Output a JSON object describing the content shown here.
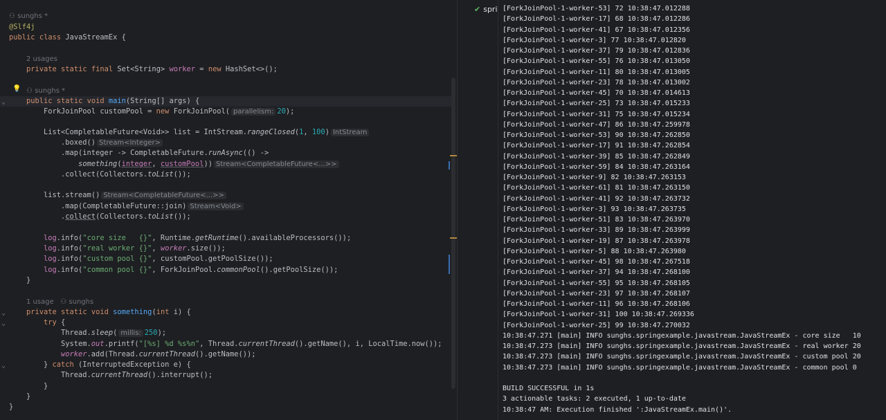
{
  "editor": {
    "author_top": "sunghs *",
    "annotation": "@Slf4j",
    "class_decl": {
      "kw1": "public",
      "kw2": "class",
      "name": "JavaStreamEx {"
    },
    "usages_worker": "2 usages",
    "field": {
      "kw": "private static final",
      "type": "Set<String>",
      "name": "worker",
      "eq": " = ",
      "new": "new",
      "rest": " HashSet<>();"
    },
    "author_main": "sunghs *",
    "main_decl": {
      "kw": "public static void",
      "name": "main",
      "rest": "(String[] args) {"
    },
    "pool_line": {
      "pre": "ForkJoinPool customPool = ",
      "new": "new",
      "cls": " ForkJoinPool(",
      "hint": "parallelism:",
      "num": "20",
      "post": ");"
    },
    "list_line": {
      "pre": "List<CompletableFuture<Void>> list = IntStream.",
      "method": "rangeClosed",
      "open": "(",
      "n1": "1",
      "comma": ", ",
      "n2": "100",
      "close": ")",
      "hint": "IntStream"
    },
    "boxed_line": {
      "text": ".boxed()",
      "hint": "Stream<Integer>"
    },
    "map_line": {
      "pre": ".map(integer -> CompletableFuture.",
      "method": "runAsync",
      "post": "(() ->"
    },
    "something_line": {
      "method": "something",
      "open": "(",
      "p1": "integer",
      "comma": ", ",
      "p2": "customPool",
      "close": "))",
      "hint": "Stream<CompletableFuture<...>>"
    },
    "collect_line1": {
      "pre": ".collect(Collectors.",
      "method": "toList",
      "post": "());"
    },
    "stream_line": {
      "text": "list.stream()",
      "hint": "Stream<CompletableFuture<...>>"
    },
    "join_line": {
      "text": ".map(CompletableFuture::join)",
      "hint": "Stream<Void>"
    },
    "collect_line2": {
      "pre": ".",
      "method": "collect",
      "mid": "(Collectors.",
      "method2": "toList",
      "post": "());"
    },
    "log1": {
      "obj": "log",
      "dot": ".info(",
      "str": "\"core size   {}\"",
      "mid": ", Runtime.",
      "m": "getRuntime",
      "post": "().availableProcessors());"
    },
    "log2": {
      "obj": "log",
      "dot": ".info(",
      "str": "\"real worker {}\"",
      "comma": ", ",
      "fld": "worker",
      "post": ".size());"
    },
    "log3": {
      "obj": "log",
      "dot": ".info(",
      "str": "\"custom pool {}\"",
      "post": ", customPool.getPoolSize());"
    },
    "log4": {
      "obj": "log",
      "dot": ".info(",
      "str": "\"common pool {}\"",
      "mid": ", ForkJoinPool.",
      "m": "commonPool",
      "post": "().getPoolSize());"
    },
    "brace_close": "}",
    "usages_something": "1 usage",
    "author_something": "sunghs",
    "something_decl": {
      "kw": "private static void",
      "name": "something",
      "open": "(",
      "kw2": "int",
      "rest": " i) {"
    },
    "try_line": {
      "kw": "try",
      "rest": " {"
    },
    "sleep_line": {
      "pre": "Thread.",
      "m": "sleep",
      "open": "(",
      "hint": "millis:",
      "num": "250",
      "post": ");"
    },
    "printf_line": {
      "pre": "System.",
      "fld": "out",
      "mid": ".printf(",
      "str": "\"[%s] %d %s%n\"",
      "mid2": ", Thread.",
      "m": "currentThread",
      "post": "().getName(), i, LocalTime.now());"
    },
    "add_line": {
      "fld": "worker",
      "mid": ".add(Thread.",
      "m": "currentThread",
      "post": "().getName());"
    },
    "catch_line": {
      "pre": "} ",
      "kw": "catch",
      "post": " (InterruptedException e) {"
    },
    "interrupt_line": {
      "pre": "Thread.",
      "m": "currentThread",
      "post": "().interrupt();"
    }
  },
  "run": {
    "tree_label": "spring",
    "console": [
      "[ForkJoinPool-1-worker-53] 72 10:38:47.012288",
      "[ForkJoinPool-1-worker-17] 68 10:38:47.012286",
      "[ForkJoinPool-1-worker-41] 67 10:38:47.012356",
      "[ForkJoinPool-1-worker-3] 77 10:38:47.012820",
      "[ForkJoinPool-1-worker-37] 79 10:38:47.012836",
      "[ForkJoinPool-1-worker-55] 76 10:38:47.013050",
      "[ForkJoinPool-1-worker-11] 80 10:38:47.013005",
      "[ForkJoinPool-1-worker-23] 78 10:38:47.013002",
      "[ForkJoinPool-1-worker-45] 70 10:38:47.014613",
      "[ForkJoinPool-1-worker-25] 73 10:38:47.015233",
      "[ForkJoinPool-1-worker-31] 75 10:38:47.015234",
      "[ForkJoinPool-1-worker-47] 86 10:38:47.259978",
      "[ForkJoinPool-1-worker-53] 90 10:38:47.262850",
      "[ForkJoinPool-1-worker-17] 91 10:38:47.262854",
      "[ForkJoinPool-1-worker-39] 85 10:38:47.262849",
      "[ForkJoinPool-1-worker-59] 84 10:38:47.263164",
      "[ForkJoinPool-1-worker-9] 82 10:38:47.263153",
      "[ForkJoinPool-1-worker-61] 81 10:38:47.263150",
      "[ForkJoinPool-1-worker-41] 92 10:38:47.263732",
      "[ForkJoinPool-1-worker-3] 93 10:38:47.263735",
      "[ForkJoinPool-1-worker-51] 83 10:38:47.263970",
      "[ForkJoinPool-1-worker-33] 89 10:38:47.263999",
      "[ForkJoinPool-1-worker-19] 87 10:38:47.263978",
      "[ForkJoinPool-1-worker-5] 88 10:38:47.263980",
      "[ForkJoinPool-1-worker-45] 98 10:38:47.267518",
      "[ForkJoinPool-1-worker-37] 94 10:38:47.268100",
      "[ForkJoinPool-1-worker-55] 95 10:38:47.268105",
      "[ForkJoinPool-1-worker-23] 97 10:38:47.268107",
      "[ForkJoinPool-1-worker-11] 96 10:38:47.268106",
      "[ForkJoinPool-1-worker-31] 100 10:38:47.269336",
      "[ForkJoinPool-1-worker-25] 99 10:38:47.270032",
      "10:38:47.271 [main] INFO sunghs.springexample.javastream.JavaStreamEx - core size   10",
      "10:38:47.273 [main] INFO sunghs.springexample.javastream.JavaStreamEx - real worker 20",
      "10:38:47.273 [main] INFO sunghs.springexample.javastream.JavaStreamEx - custom pool 20",
      "10:38:47.273 [main] INFO sunghs.springexample.javastream.JavaStreamEx - common pool 0",
      "",
      "BUILD SUCCESSFUL in 1s",
      "3 actionable tasks: 2 executed, 1 up-to-date",
      "10:38:47 AM: Execution finished ':JavaStreamEx.main()'."
    ]
  }
}
